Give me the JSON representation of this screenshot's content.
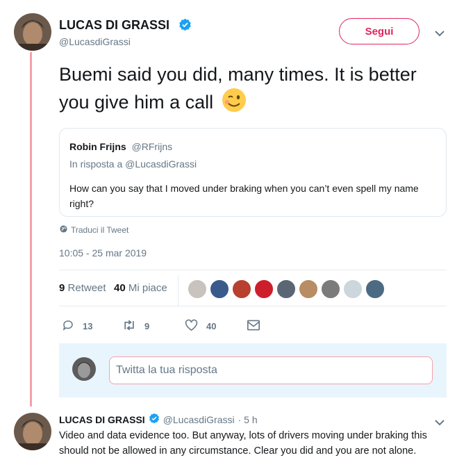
{
  "main_tweet": {
    "author_name": "LUCAS DI GRASSI",
    "author_handle": "@LucasdiGrassi",
    "follow_label": "Segui",
    "text": "Buemi said you did, many times. It is better you give him a call",
    "emoji": "winking-face",
    "quoted": {
      "author_name": "Robin Frijns",
      "author_handle": "@RFrijns",
      "reply_to": "In risposta a @LucasdiGrassi",
      "text": "How can you say that I moved under braking when you can’t even spell my name right?"
    },
    "translate_label": "Traduci il Tweet",
    "timestamp": "10:05 - 25 mar 2019",
    "stats": {
      "retweets_count": "9",
      "retweets_label": "Retweet",
      "likes_count": "40",
      "likes_label": "Mi piace"
    },
    "actions": {
      "reply_count": "13",
      "retweet_count": "9",
      "like_count": "40"
    }
  },
  "reply_box": {
    "placeholder": "Twitta la tua risposta"
  },
  "reply_tweet": {
    "author_name": "LUCAS DI GRASSI",
    "author_handle": "@LucasdiGrassi",
    "time": "· 5 h",
    "text": "Video and data evidence too. But anyway, lots of drivers moving under braking this should not be allowed in any circumstance. Clear you did and you are not alone."
  },
  "colors": {
    "accent": "#e0245e",
    "verified": "#1da1f2",
    "thread_line": "#f5a0a9",
    "muted": "#657786"
  }
}
